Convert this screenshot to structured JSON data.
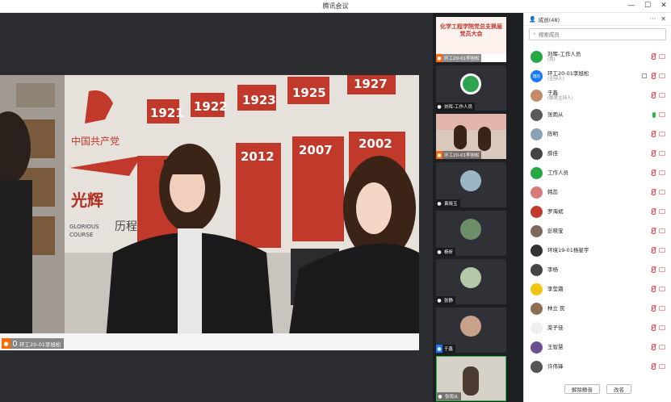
{
  "window": {
    "title": "腾讯会议",
    "minimize": "—",
    "maximize": "☐",
    "close": "✕"
  },
  "main_video": {
    "speaker": "环工20-01李旭松",
    "wall_years": [
      "1921",
      "1922",
      "1923",
      "1925",
      "1927",
      "2012",
      "2007",
      "2002"
    ],
    "wall_text": [
      "中国共产党",
      "光辉",
      "历程",
      "GLORIOUS",
      "COURSE"
    ]
  },
  "tiles": [
    {
      "name": "环工20-01李旭松",
      "banner": "化学工程学院党总支换届党员大会",
      "badge": "orange"
    },
    {
      "name": "刘晖-工作人员",
      "badge": "none"
    },
    {
      "name": "环工20-01李旭松",
      "badge": "orange"
    },
    {
      "name": "袁晓玉",
      "badge": "none"
    },
    {
      "name": "杨昕",
      "badge": "none"
    },
    {
      "name": "张静",
      "badge": "none"
    },
    {
      "name": "于鑫",
      "badge": "blue"
    },
    {
      "name": "张雨从",
      "badge": "none"
    }
  ],
  "panel": {
    "title": "成员(48)",
    "more": "···",
    "close": "✕",
    "search_placeholder": "搜索成员",
    "members": [
      {
        "name": "刘晖-工作人员",
        "role": "(我)",
        "av": "#28a745",
        "mic": "off",
        "share": false
      },
      {
        "name": "环工20-01李旭松",
        "role": "(主持人)",
        "av": "#1677ff",
        "av_text": "旭松",
        "mic": "off",
        "share": true
      },
      {
        "name": "于鑫",
        "role": "(联席主持人)",
        "av": "#c48b6b",
        "mic": "off",
        "share": false
      },
      {
        "name": "张雨从",
        "role": "",
        "av": "#5a5a5a",
        "mic": "on",
        "share": false
      },
      {
        "name": "陈明",
        "role": "",
        "av": "#8aa0b5",
        "mic": "off",
        "share": false
      },
      {
        "name": "薛佳",
        "role": "",
        "av": "#444",
        "mic": "off",
        "share": false
      },
      {
        "name": "工作人员",
        "role": "",
        "av": "#28a745",
        "mic": "off",
        "share": false
      },
      {
        "name": "韩蕊",
        "role": "",
        "av": "#d97b7b",
        "mic": "off",
        "share": false
      },
      {
        "name": "罗海斌",
        "role": "",
        "av": "#c0392b",
        "mic": "off",
        "share": false
      },
      {
        "name": "彭晓宝",
        "role": "",
        "av": "#7d6a5a",
        "mic": "off",
        "share": false
      },
      {
        "name": "环境19-01杨星宇",
        "role": "",
        "av": "#333",
        "mic": "off",
        "share": false
      },
      {
        "name": "李杨",
        "role": "",
        "av": "#444",
        "mic": "off",
        "share": false
      },
      {
        "name": "李莹霜",
        "role": "",
        "av": "#f1c40f",
        "mic": "off",
        "share": false
      },
      {
        "name": "林立 民",
        "role": "",
        "av": "#8e6e53",
        "mic": "off",
        "share": false
      },
      {
        "name": "栾子佳",
        "role": "",
        "av": "#eee",
        "mic": "off",
        "share": false
      },
      {
        "name": "王智慧",
        "role": "",
        "av": "#6c4f91",
        "mic": "off",
        "share": false
      },
      {
        "name": "许伟锋",
        "role": "",
        "av": "#555",
        "mic": "off",
        "share": false
      }
    ],
    "btn_unmute": "解除静音",
    "btn_rename": "改名"
  },
  "colors": {
    "host": "#ff6a00",
    "blue": "#1677ff",
    "mic_off": "#ee4b4b",
    "mic_on": "#2db84d"
  }
}
